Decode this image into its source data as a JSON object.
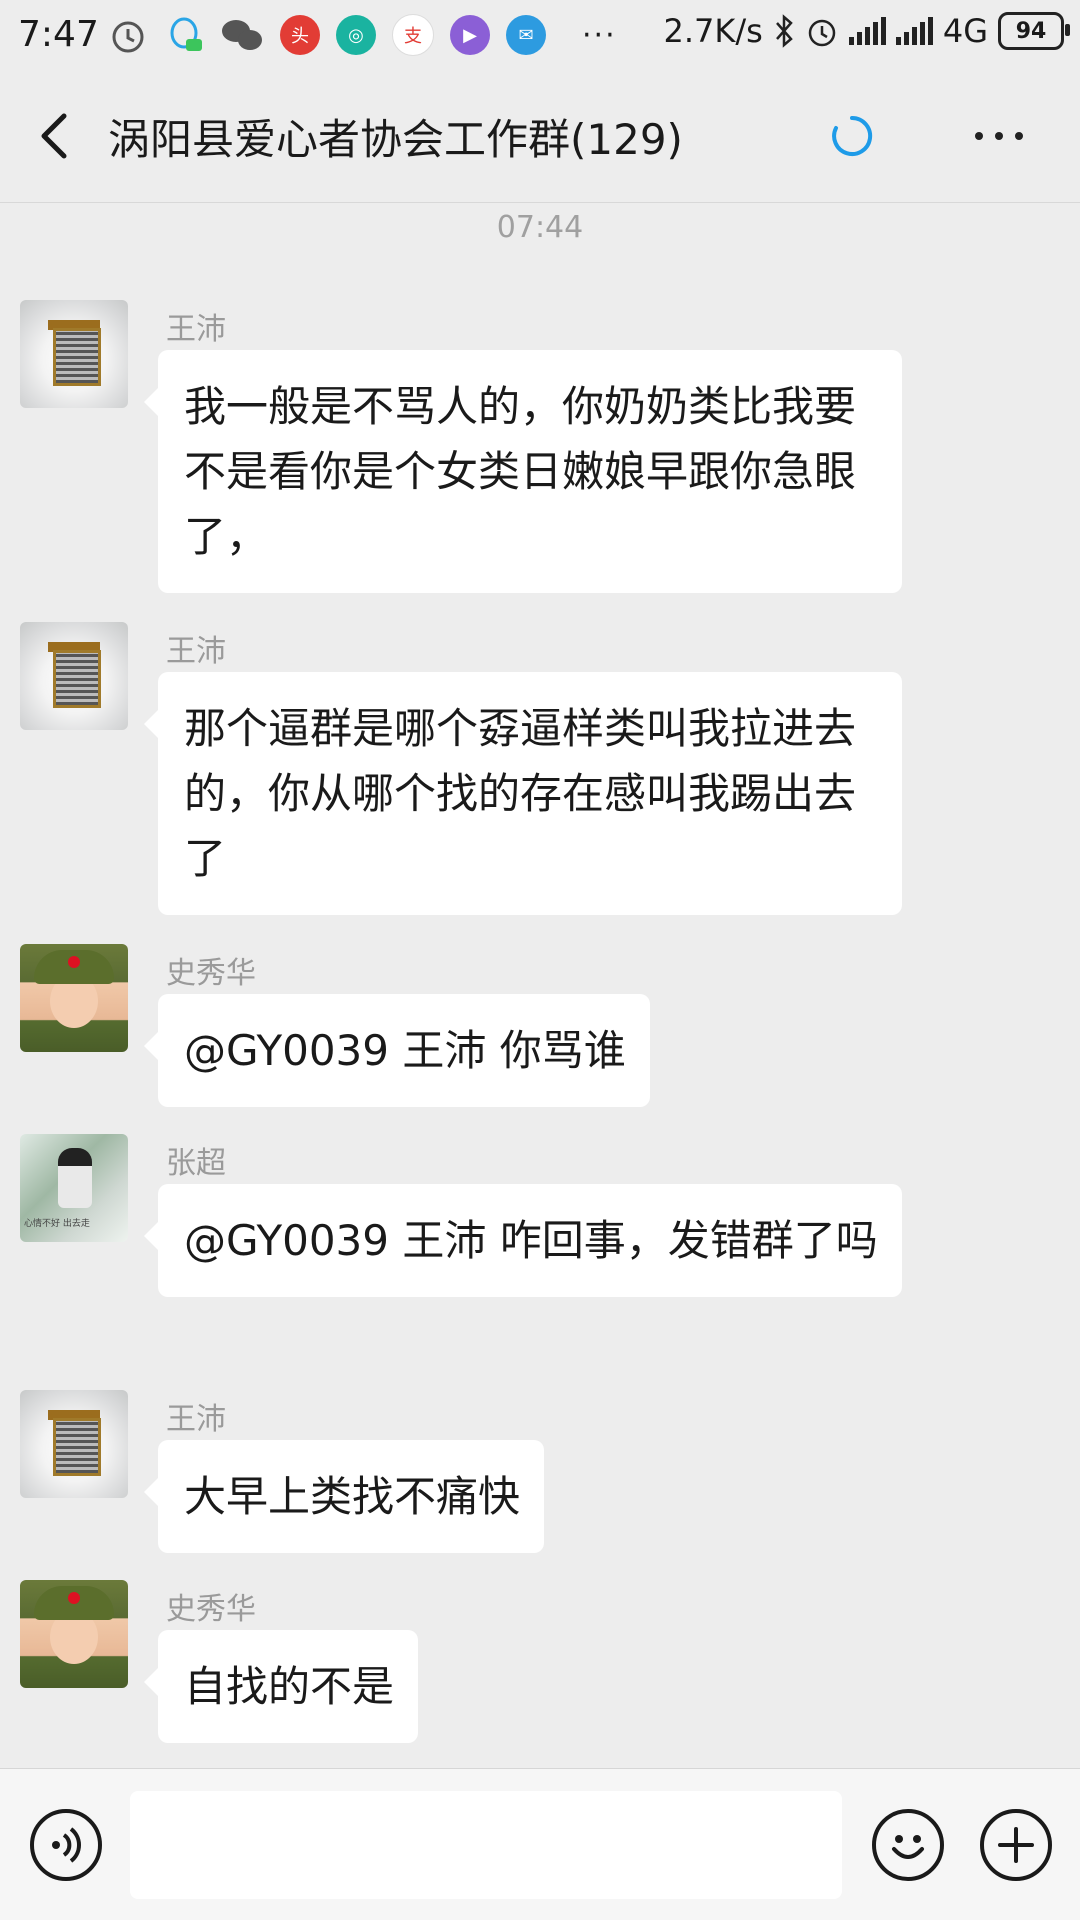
{
  "status_bar": {
    "time": "7:47",
    "net_speed": "2.7K/s",
    "network": "4G",
    "battery": "94",
    "overflow": "···"
  },
  "header": {
    "title": "涡阳县爱心者协会工作群(129)"
  },
  "timestamp": "07:44",
  "messages": [
    {
      "sender": "王沛",
      "text": "我一般是不骂人的，你奶奶类比我要不是看你是个女类日嫩娘早跟你急眼了，"
    },
    {
      "sender": "王沛",
      "text": "那个逼群是哪个孬逼样类叫我拉进去的，你从哪个找的存在感叫我踢出去了"
    },
    {
      "sender": "史秀华",
      "text": "@GY0039 王沛  你骂谁"
    },
    {
      "sender": "张超",
      "text": "@GY0039 王沛  咋回事，发错群了吗"
    },
    {
      "sender": "王沛",
      "text": "大早上类找不痛快"
    },
    {
      "sender": "史秀华",
      "text": "自找的不是"
    }
  ],
  "avatar_captions": {
    "zhang": "心情不好  出去走"
  },
  "colors": {
    "background": "#ededed",
    "bubble": "#ffffff",
    "accent": "#1e9be8"
  }
}
